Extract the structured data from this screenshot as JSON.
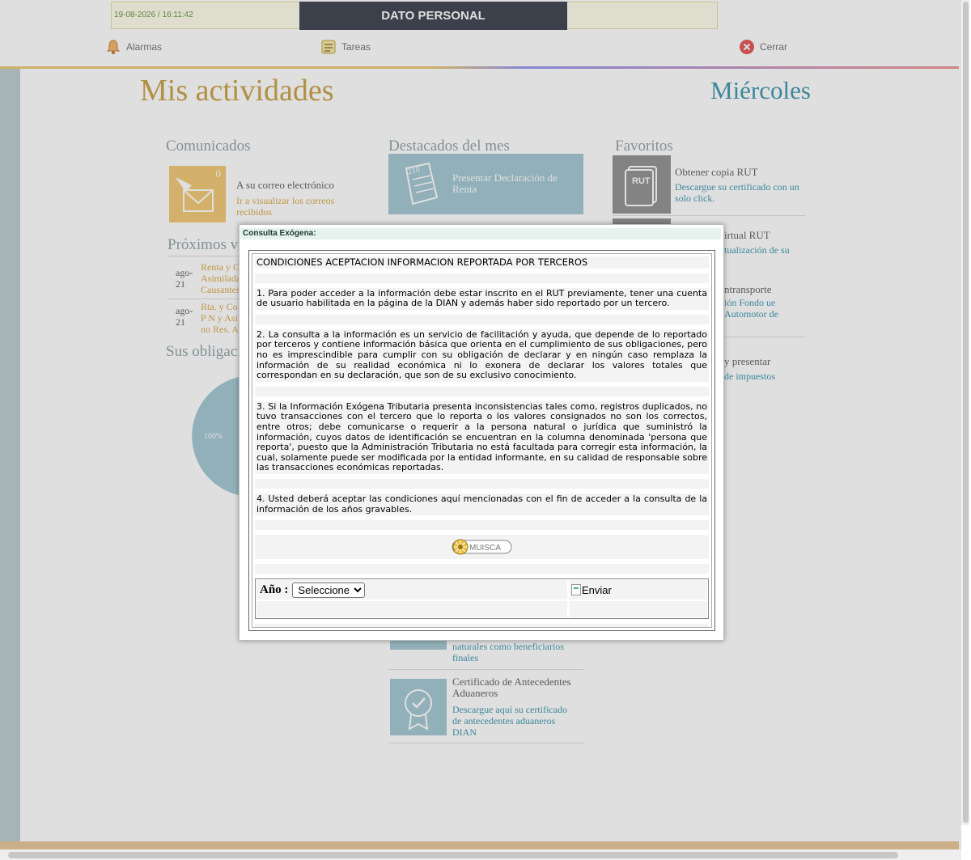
{
  "header": {
    "datetime": "19-08-2026 / 16:11:42",
    "title": "DATO PERSONAL",
    "nav": {
      "alarms": "Alarmas",
      "tasks": "Tareas",
      "close": "Cerrar"
    }
  },
  "page": {
    "heading": "Mis actividades",
    "day": "Miércoles",
    "comunicados": {
      "title": "Comunicados",
      "count": "0",
      "item_title": "A su correo electrónico",
      "item_link": "Ir a visualizar los correos recibidos"
    },
    "destacados": {
      "title": "Destacados del mes",
      "tile_number": "210",
      "tile_text": "Presentar Declaración de Renta",
      "partial_text": "naturales como beneficiarios finales",
      "item2_title": "Certificado de Antecedentes Aduaneros",
      "item2_link": "Descargue aquí su certificado de antecedentes aduaneros DIAN"
    },
    "favoritos": {
      "title": "Favoritos",
      "rut_label": "RUT",
      "item1_title": "Obtener copia RUT",
      "item1_link": "Descargue su certificado con un solo click.",
      "item2_title_partial": "irtual RUT",
      "item2_link_partial": "tualización de su",
      "item3_title_partial": "ntransporte",
      "item3_link_partial": "ión Fondo ue Automotor de",
      "item4_title_partial": "y presentar",
      "item4_link_partial": "de impuestos"
    },
    "proximos": {
      "title": "Próximos ve",
      "items": [
        {
          "date": "ago-21",
          "text": "Renta y C Asimilada Causantes"
        },
        {
          "date": "ago-21",
          "text": "Rta. y Co P N y Asi no Res. A"
        }
      ]
    },
    "obligaciones": {
      "title": "Sus obligaci",
      "pie_label": "100%"
    }
  },
  "modal": {
    "title": "Consulta Exógena:",
    "heading": "CONDICIONES ACEPTACION INFORMACION REPORTADA POR TERCEROS",
    "paragraphs": [
      "1. Para poder acceder a la información debe estar inscrito en el RUT previamente, tener una cuenta de usuario habilitada en la página de la DIAN y además haber sido reportado por un tercero.",
      "2. La consulta a la información es un servicio de facilitación y ayuda, que depende de lo reportado por terceros y contiene información básica que orienta en el cumplimiento de sus obligaciones, pero no es imprescindible para cumplir con su obligación de declarar y en ningún caso remplaza la información de su realidad económica ni lo exonera de declarar los valores totales que correspondan en su declaración, que son de su exclusivo conocimiento.",
      "3. Si la Información Exógena Tributaria presenta inconsistencias tales como, registros duplicados, no tuvo transacciones con el tercero que lo reporta o los valores consignados no son los correctos, entre otros; debe comunicarse o requerir a la persona natural o jurídica que suministró la información, cuyos datos de identificación se encuentran en la columna denominada 'persona que reporta', puesto que la Administración Tributaria no está facultada para corregir esta información, la cual, solamente puede ser modificada por la entidad informante, en su calidad de responsable sobre las transacciones económicas reportadas.",
      "4. Usted deberá aceptar las condiciones aquí mencionadas con el fin de acceder a la consulta de la información de los años gravables."
    ],
    "logo_text": "MUISCA",
    "year_label": "Año :",
    "year_select": "Seleccione",
    "submit_label": "Enviar"
  },
  "colors": {
    "title_bg": "#2e3440",
    "gold": "#d8a23a",
    "teal": "#2f8fa8",
    "tile_blue": "#9cc3cf"
  }
}
